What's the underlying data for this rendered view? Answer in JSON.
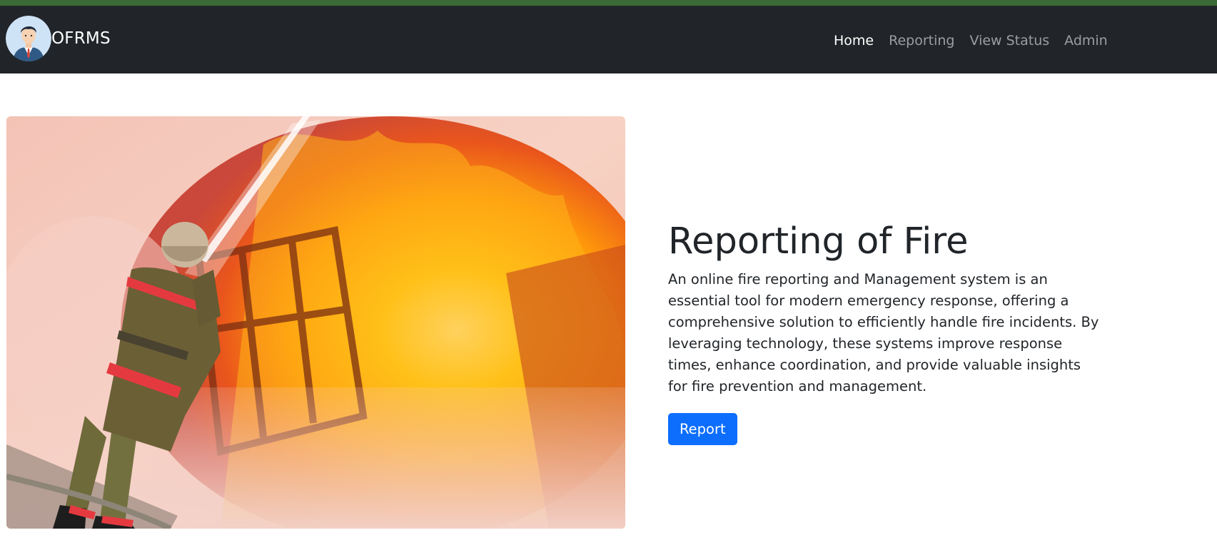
{
  "navbar": {
    "brand": "OFRMS",
    "links": [
      {
        "label": "Home",
        "active": true
      },
      {
        "label": "Reporting",
        "active": false
      },
      {
        "label": "View Status",
        "active": false
      },
      {
        "label": "Admin",
        "active": false
      }
    ]
  },
  "hero": {
    "title": "Reporting of Fire",
    "description": "An online fire reporting and Management system is an essential tool for modern emergency response, offering a comprehensive solution to efficiently handle fire incidents. By leveraging technology, these systems improve response times, enhance coordination, and provide valuable insights for fire prevention and management.",
    "button_label": "Report"
  },
  "colors": {
    "top_strip": "#3a6a35",
    "navbar_bg": "#212529",
    "primary": "#0d6efd",
    "nav_active": "#ffffff",
    "nav_inactive": "rgba(255,255,255,0.55)"
  },
  "icons": {
    "avatar": "user-avatar-icon"
  }
}
